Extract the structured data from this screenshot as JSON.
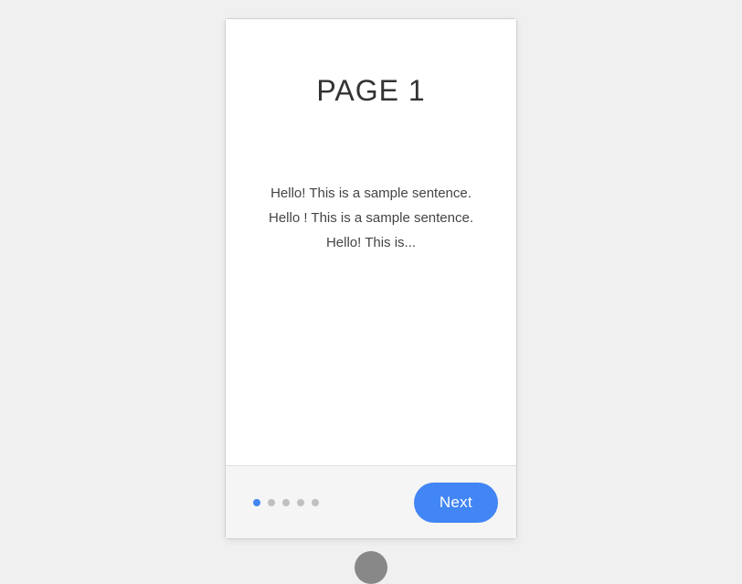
{
  "page": {
    "title": "PAGE 1",
    "lines": [
      "Hello! This is a sample sentence.",
      "Hello ! This is a sample sentence.",
      "Hello! This is..."
    ]
  },
  "bottom": {
    "next_label": "Next",
    "dots": [
      {
        "active": true
      },
      {
        "active": false
      },
      {
        "active": false
      },
      {
        "active": false
      },
      {
        "active": false
      }
    ]
  }
}
